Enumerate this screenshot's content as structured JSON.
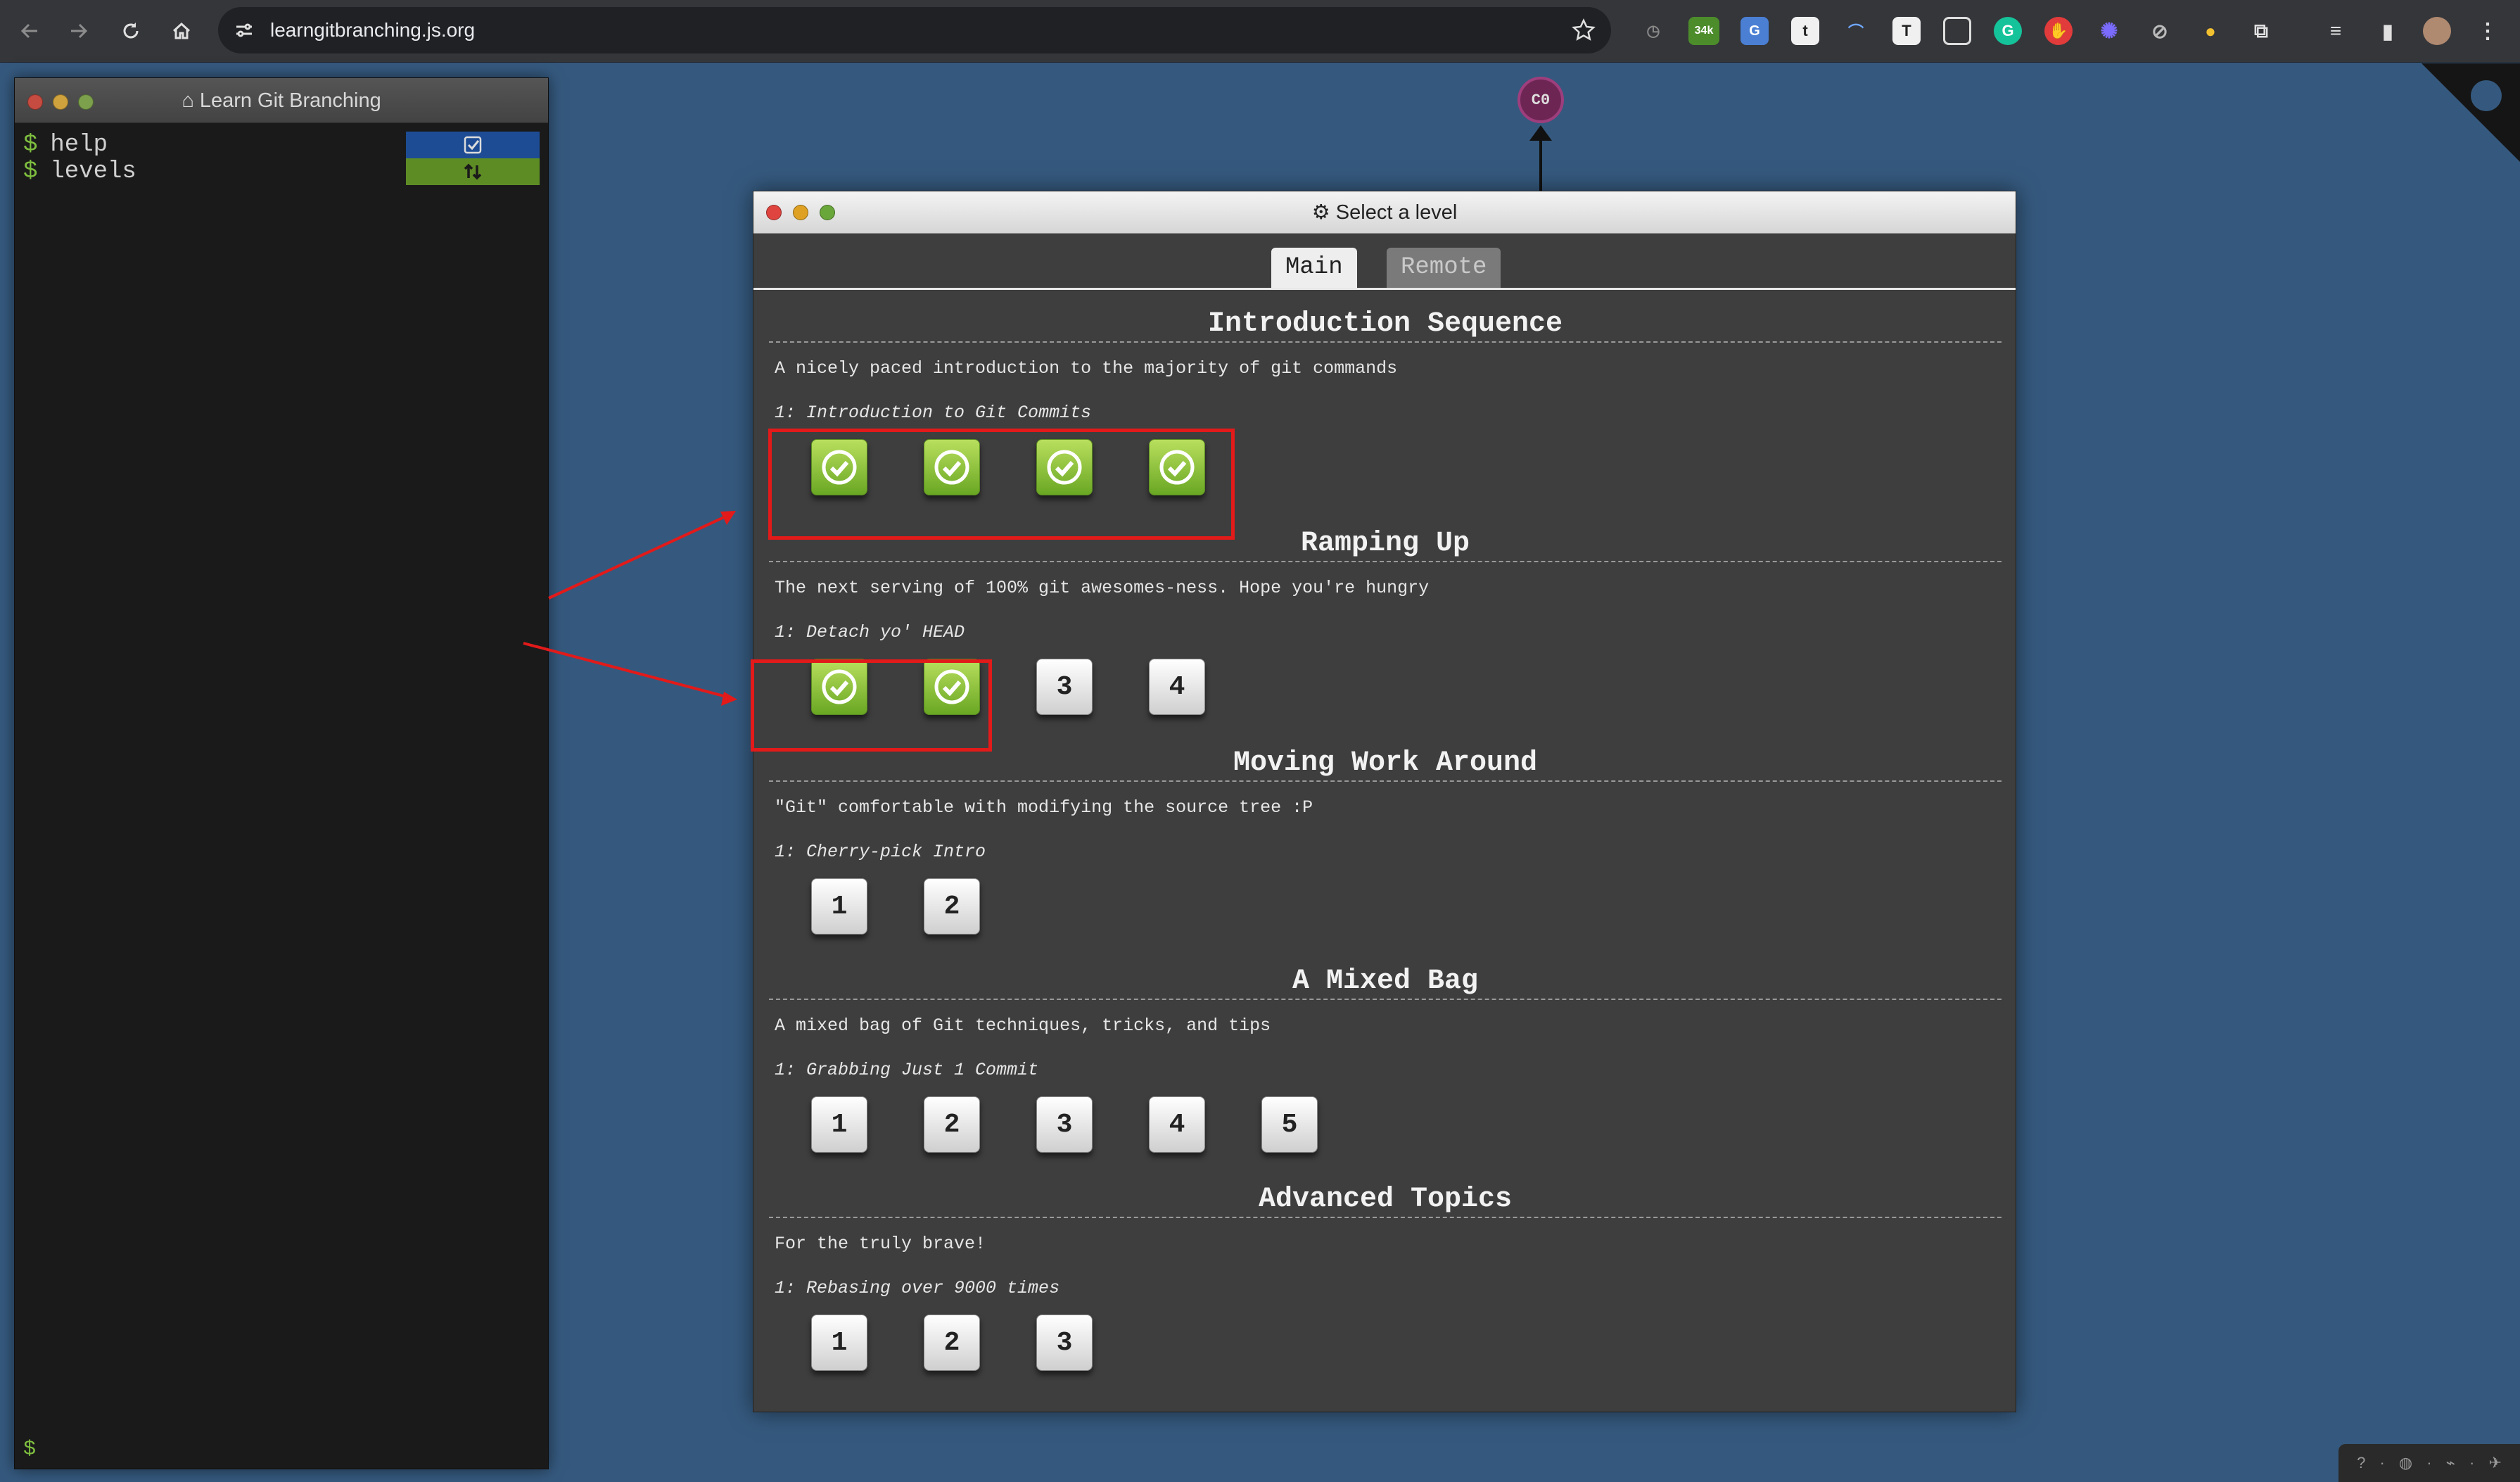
{
  "browser": {
    "url": "learngitbranching.js.org",
    "extension_badge": "34k"
  },
  "terminal": {
    "title": "Learn Git Branching",
    "prompt": "$",
    "history": [
      {
        "prompt": "$",
        "command": "help",
        "status": "done",
        "status_color": "#1d4c94"
      },
      {
        "prompt": "$",
        "command": "levels",
        "status": "refresh",
        "status_color": "#5e8c24"
      }
    ]
  },
  "graph": {
    "nodes": [
      {
        "label": "C0",
        "color": "#6d2653"
      }
    ]
  },
  "level_window": {
    "title": "Select a level",
    "tabs": [
      {
        "label": "Main",
        "active": true
      },
      {
        "label": "Remote",
        "active": false
      }
    ],
    "sequences": [
      {
        "title": "Introduction Sequence",
        "description": "A nicely paced introduction to the majority of git commands",
        "selected": "1: Introduction to Git Commits",
        "levels": [
          {
            "label": "1",
            "completed": true
          },
          {
            "label": "2",
            "completed": true
          },
          {
            "label": "3",
            "completed": true
          },
          {
            "label": "4",
            "completed": true
          }
        ]
      },
      {
        "title": "Ramping Up",
        "description": "The next serving of 100% git awesomes-ness. Hope you're hungry",
        "selected": "1: Detach yo' HEAD",
        "levels": [
          {
            "label": "1",
            "completed": true
          },
          {
            "label": "2",
            "completed": true
          },
          {
            "label": "3",
            "completed": false
          },
          {
            "label": "4",
            "completed": false
          }
        ]
      },
      {
        "title": "Moving Work Around",
        "description": "\"Git\" comfortable with modifying the source tree :P",
        "selected": "1: Cherry-pick Intro",
        "levels": [
          {
            "label": "1",
            "completed": false
          },
          {
            "label": "2",
            "completed": false
          }
        ]
      },
      {
        "title": "A Mixed Bag",
        "description": "A mixed bag of Git techniques, tricks, and tips",
        "selected": "1: Grabbing Just 1 Commit",
        "levels": [
          {
            "label": "1",
            "completed": false
          },
          {
            "label": "2",
            "completed": false
          },
          {
            "label": "3",
            "completed": false
          },
          {
            "label": "4",
            "completed": false
          },
          {
            "label": "5",
            "completed": false
          }
        ]
      },
      {
        "title": "Advanced Topics",
        "description": "For the truly brave!",
        "selected": "1: Rebasing over 9000 times",
        "levels": [
          {
            "label": "1",
            "completed": false
          },
          {
            "label": "2",
            "completed": false
          },
          {
            "label": "3",
            "completed": false
          }
        ]
      }
    ]
  },
  "annotations": {
    "highlight_color": "#e21a1a",
    "highlighted": [
      "Introduction Sequence levels 1-4",
      "Ramping Up levels 1-2"
    ]
  }
}
